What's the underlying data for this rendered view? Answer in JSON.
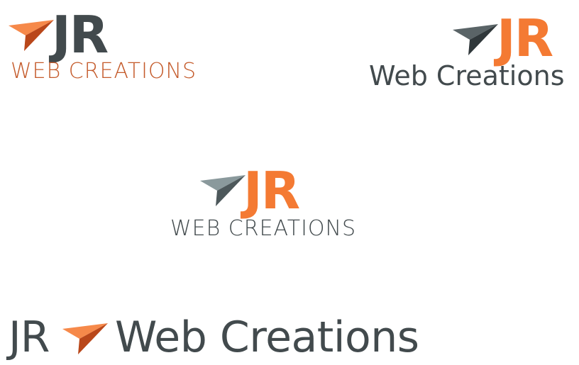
{
  "colors": {
    "charcoal": "#424a4d",
    "orange": "#f47a33",
    "burnt_orange": "#c0531e",
    "grey_plane": "#7b8b8e",
    "grey_plane_dark": "#4d585b",
    "tagline_orange": "#c45a2a"
  },
  "logos": [
    {
      "variant": "top-left",
      "icon": "paper-plane-icon",
      "mark": "JR",
      "tagline": "WEB CREATIONS",
      "mark_color": "#424a4d",
      "tagline_color": "#c45a2a",
      "plane_color": "#f47a33"
    },
    {
      "variant": "top-right",
      "icon": "paper-plane-icon",
      "mark": "JR",
      "tagline": "Web Creations",
      "mark_color": "#f47a33",
      "tagline_color": "#424a4d",
      "plane_color": "#424a4d"
    },
    {
      "variant": "center",
      "icon": "paper-plane-icon",
      "mark": "JR",
      "tagline": "WEB CREATIONS",
      "mark_color": "#f47a33",
      "tagline_color": "#424a4d",
      "plane_color": "#7b8b8e"
    },
    {
      "variant": "bottom-horizontal",
      "icon": "paper-plane-icon",
      "mark": "JR",
      "tagline": "Web Creations",
      "mark_color": "#424a4d",
      "tagline_color": "#424a4d",
      "plane_color": "#f47a33"
    }
  ]
}
